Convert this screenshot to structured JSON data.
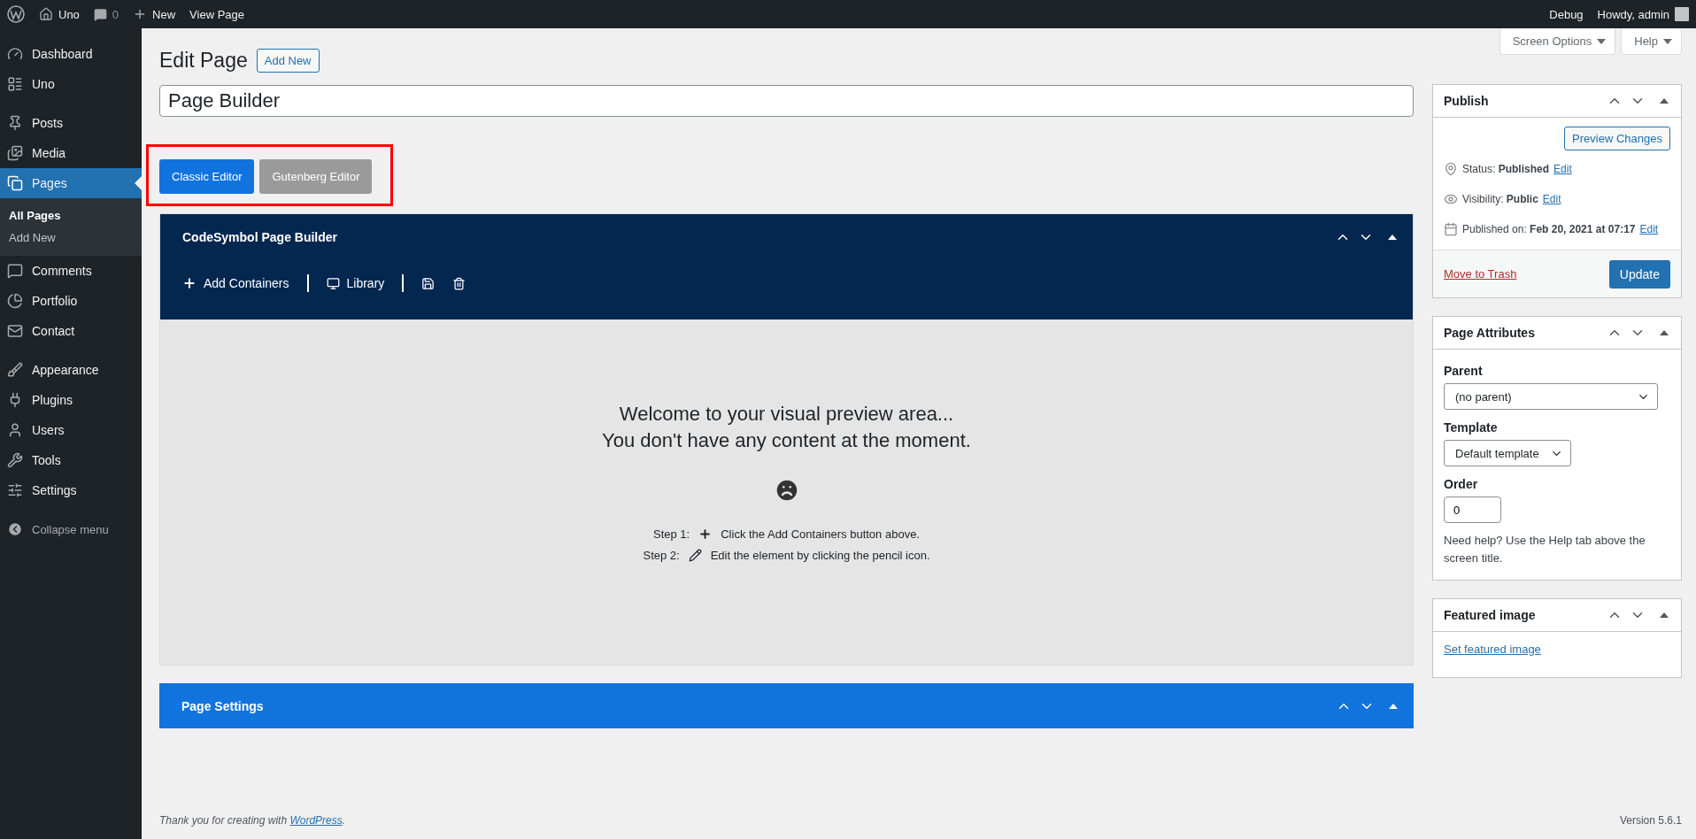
{
  "admin_bar": {
    "site": "Uno",
    "comments": "0",
    "new": "New",
    "view": "View Page",
    "debug": "Debug",
    "greeting": "Howdy, admin"
  },
  "sidebar": {
    "sections": [
      [
        {
          "label": "Dashboard",
          "selected": false
        },
        {
          "label": "Uno",
          "selected": false
        }
      ],
      [
        {
          "label": "Posts",
          "selected": false
        },
        {
          "label": "Media",
          "selected": false
        },
        {
          "label": "Pages",
          "selected": true,
          "children": [
            {
              "label": "All Pages",
              "selected": true
            },
            {
              "label": "Add New",
              "selected": false
            }
          ]
        },
        {
          "label": "Comments",
          "selected": false
        },
        {
          "label": "Portfolio",
          "selected": false
        },
        {
          "label": "Contact",
          "selected": false
        }
      ],
      [
        {
          "label": "Appearance",
          "selected": false
        },
        {
          "label": "Plugins",
          "selected": false
        },
        {
          "label": "Users",
          "selected": false
        },
        {
          "label": "Tools",
          "selected": false
        },
        {
          "label": "Settings",
          "selected": false
        }
      ]
    ],
    "collapse": "Collapse menu"
  },
  "screen_tabs": [
    "Screen Options",
    "Help"
  ],
  "heading": {
    "title": "Edit Page",
    "add_new": "Add New"
  },
  "title_field": {
    "value": "Page Builder"
  },
  "editor_switch": [
    {
      "label": "Classic Editor",
      "selected": true
    },
    {
      "label": "Gutenberg Editor",
      "selected": false
    }
  ],
  "builder": {
    "title": "CodeSymbol Page Builder",
    "toolbar": [
      "Add Containers",
      "Library"
    ],
    "welcome": [
      "Welcome to your visual preview area...",
      "You don't have any content at the moment."
    ],
    "steps": [
      {
        "label": "Step 1:",
        "text": "Click the Add Containers button above."
      },
      {
        "label": "Step 2:",
        "text": "Edit the element by clicking the pencil icon."
      }
    ]
  },
  "page_settings": {
    "title": "Page Settings"
  },
  "publish": {
    "title": "Publish",
    "preview": "Preview Changes",
    "rows": [
      {
        "label": "Status:",
        "value": "Published",
        "link": "Edit"
      },
      {
        "label": "Visibility:",
        "value": "Public",
        "link": "Edit"
      },
      {
        "label": "Published on:",
        "value": "Feb 20, 2021 at 07:17",
        "link": "Edit"
      }
    ],
    "trash": "Move to Trash",
    "update": "Update"
  },
  "page_attributes": {
    "title": "Page Attributes",
    "parent_label": "Parent",
    "parent": "(no parent)",
    "template_label": "Template",
    "template": "Default template",
    "order_label": "Order",
    "order": "0",
    "help": "Need help? Use the Help tab above the screen title."
  },
  "featured_image": {
    "title": "Featured image",
    "link": "Set featured image"
  },
  "footer": {
    "thanks": "Thank you for creating with",
    "link": "WordPress",
    "end": ".",
    "version": "Version 5.6.1"
  }
}
